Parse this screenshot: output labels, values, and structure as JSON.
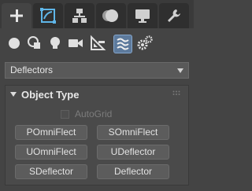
{
  "command_tabs": [
    {
      "name": "create",
      "icon": "plus-icon"
    },
    {
      "name": "modify",
      "icon": "modify-icon"
    },
    {
      "name": "hierarchy",
      "icon": "hierarchy-icon"
    },
    {
      "name": "motion",
      "icon": "motion-icon"
    },
    {
      "name": "display",
      "icon": "display-icon"
    },
    {
      "name": "utilities",
      "icon": "wrench-icon"
    }
  ],
  "category_icons": [
    {
      "name": "geometry",
      "icon": "sphere-icon"
    },
    {
      "name": "shapes",
      "icon": "shapes-icon"
    },
    {
      "name": "lights",
      "icon": "bulb-icon"
    },
    {
      "name": "cameras",
      "icon": "camera-icon"
    },
    {
      "name": "helpers",
      "icon": "helpers-icon"
    },
    {
      "name": "space-warps",
      "icon": "space-warp-icon"
    },
    {
      "name": "systems",
      "icon": "gears-icon"
    }
  ],
  "subcategory_dropdown": {
    "selected": "Deflectors"
  },
  "rollout": {
    "title": "Object Type",
    "autogrid_label": "AutoGrid",
    "autogrid_checked": false,
    "buttons": [
      "POmniFlect",
      "SOmniFlect",
      "UOmniFlect",
      "UDeflector",
      "SDeflector",
      "Deflector"
    ]
  },
  "colors": {
    "panel_bg": "#444444",
    "active_category": "#5d7a9c"
  }
}
